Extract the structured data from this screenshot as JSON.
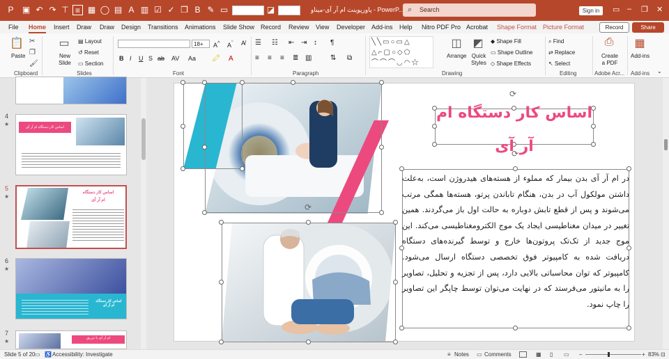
{
  "titlebar": {
    "title": "پاورپوینت ام آر آی-میناو  -  PowerP...",
    "search_placeholder": "Search",
    "sign_in": "Sign in",
    "font_box": "",
    "size_box": ""
  },
  "menu": {
    "tabs": [
      "File",
      "Home",
      "Insert",
      "Draw",
      "Draw",
      "Design",
      "Transitions",
      "Animations",
      "Slide Show",
      "Record",
      "Review",
      "View",
      "Developer",
      "Add-ins",
      "Help",
      "Nitro PDF Pro",
      "Acrobat",
      "Shape Format",
      "Picture Format"
    ],
    "active": "Home",
    "record": "Record",
    "share": "Share"
  },
  "ribbon": {
    "paste": "Paste",
    "new_slide": "New Slide",
    "layout": "Layout",
    "reset": "Reset",
    "section": "Section",
    "font_size": "18+",
    "arrange": "Arrange",
    "quick_styles": "Quick Styles",
    "shape_fill": "Shape Fill",
    "shape_outline": "Shape Outline",
    "shape_effects": "Shape Effects",
    "find": "Find",
    "replace": "Replace",
    "select": "Select",
    "create_pdf": "Create a PDF",
    "add_ins": "Add-ins",
    "groups": {
      "clipboard": "Clipboard",
      "slides": "Slides",
      "font": "Font",
      "paragraph": "Paragraph",
      "drawing": "Drawing",
      "editing": "Editing",
      "adobe": "Adobe Acr...",
      "addins": "Add-ins"
    }
  },
  "thumbnails": [
    {
      "num": "4",
      "title": "اساس کار دستگاه ام آر آی"
    },
    {
      "num": "5",
      "title": "اساس کار دستگاه",
      "subtitle": "ام آر آی"
    },
    {
      "num": "6",
      "title": "اساس کار دستگاه ام آر آی"
    },
    {
      "num": "7",
      "title": "ام آر آی با تزریق"
    }
  ],
  "slide": {
    "title": "اساس کار دستگاه ام آر آی",
    "body": "در ام آر آی بدن بیمار که مملوء از هسته‌های هیدروژن است، به‌علت داشتن مولکول آب در بدن، هنگام تاباندن پرتو، هسته‌ها همگی مرتب می‌شوند و پس از قطع تابش دوباره به حالت اول باز می‌گردند. همین تغییر در میدان مغناطیسی ایجاد یک موج الکترومغناطیسی می‌کند. این موج جدید از تک‌تک پروتون‌ها خارج و توسط گیرنده‌های دستگاه دریافت شده به کامپیوتر فوق تخصصی دستگاه ارسال می‌شود. کامپیوتر که توان محاسباتی بالایی دارد، پس از تجزیه و تحلیل، تصاویر را به مانیتور می‌فرستد که در نهایت می‌توان توسط چاپگر این تصاویر را چاپ نمود."
  },
  "status": {
    "slide_of": "Slide 5 of 20",
    "accessibility": "Accessibility: Investigate",
    "notes": "Notes",
    "comments": "Comments",
    "zoom": "83%"
  },
  "colors": {
    "accent": "#b7472a",
    "pink": "#ec4a7f",
    "cyan": "#29b6d1"
  }
}
